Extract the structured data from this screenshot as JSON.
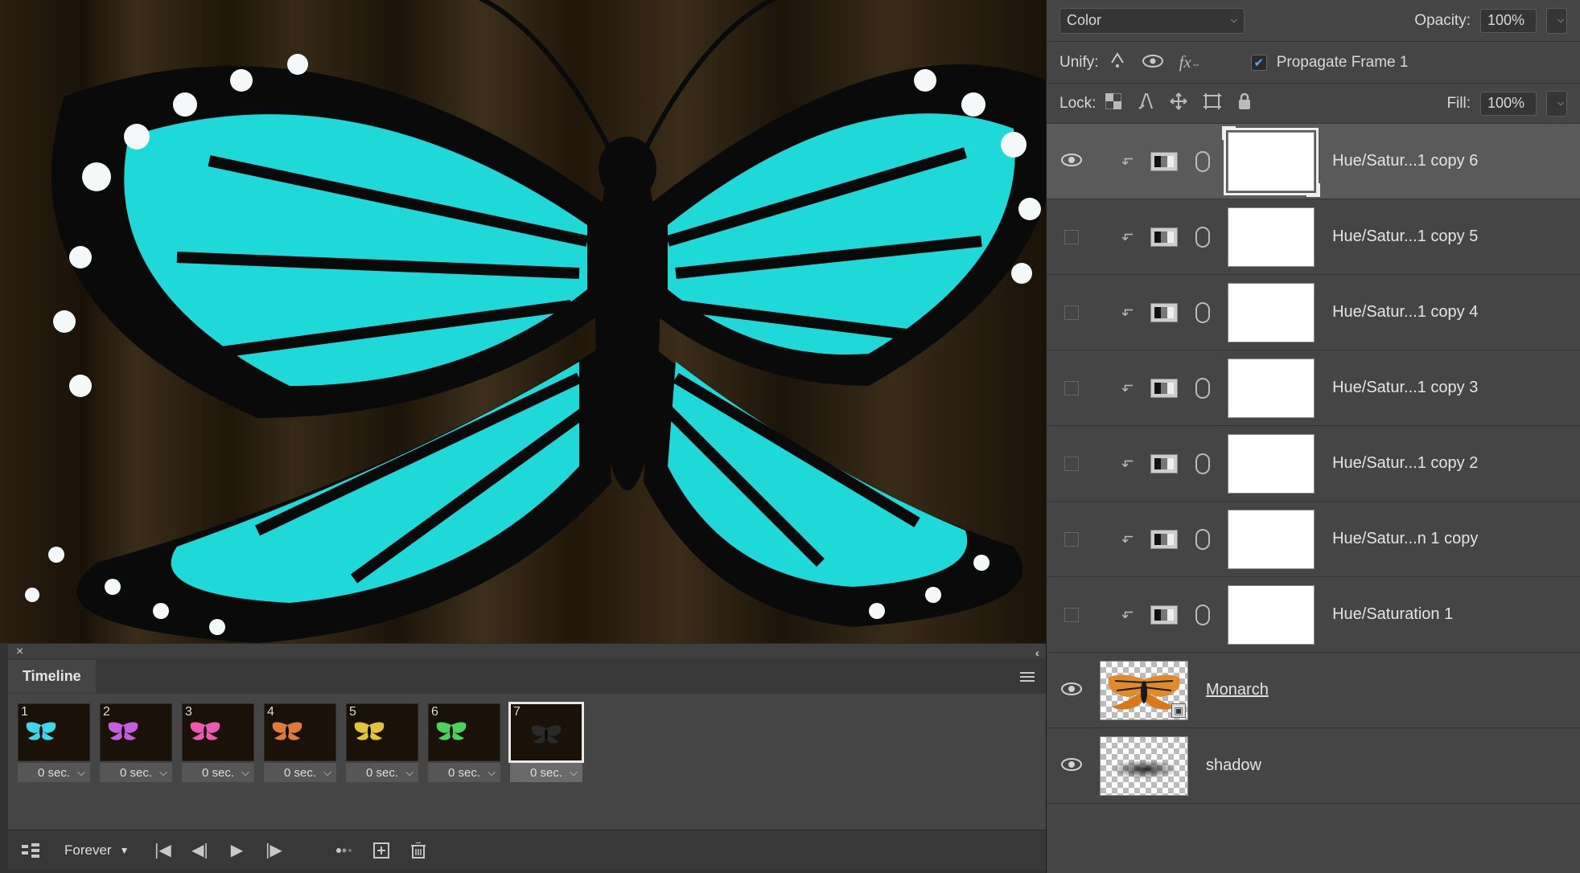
{
  "blend_mode": "Color",
  "opacity_label": "Opacity:",
  "opacity_value": "100%",
  "unify_label": "Unify:",
  "propagate_label": "Propagate Frame 1",
  "propagate_checked": true,
  "lock_label": "Lock:",
  "fill_label": "Fill:",
  "fill_value": "100%",
  "layers": [
    {
      "name": "Hue/Satur...1 copy 6",
      "visible": true,
      "selected": true,
      "kind": "adj"
    },
    {
      "name": "Hue/Satur...1 copy 5",
      "visible": false,
      "selected": false,
      "kind": "adj"
    },
    {
      "name": "Hue/Satur...1 copy 4",
      "visible": false,
      "selected": false,
      "kind": "adj"
    },
    {
      "name": "Hue/Satur...1 copy 3",
      "visible": false,
      "selected": false,
      "kind": "adj"
    },
    {
      "name": "Hue/Satur...1 copy 2",
      "visible": false,
      "selected": false,
      "kind": "adj"
    },
    {
      "name": "Hue/Satur...n 1 copy",
      "visible": false,
      "selected": false,
      "kind": "adj"
    },
    {
      "name": "Hue/Saturation 1",
      "visible": false,
      "selected": false,
      "kind": "adj"
    },
    {
      "name": "Monarch",
      "visible": true,
      "selected": false,
      "kind": "smart"
    },
    {
      "name": "shadow",
      "visible": true,
      "selected": false,
      "kind": "shadow"
    }
  ],
  "timeline": {
    "tab": "Timeline",
    "loop": "Forever",
    "frames": [
      {
        "n": "1",
        "delay": "0 sec.",
        "color": "#3fd7e8",
        "selected": false
      },
      {
        "n": "2",
        "delay": "0 sec.",
        "color": "#c45de0",
        "selected": false
      },
      {
        "n": "3",
        "delay": "0 sec.",
        "color": "#e85bb0",
        "selected": false
      },
      {
        "n": "4",
        "delay": "0 sec.",
        "color": "#e07a3a",
        "selected": false
      },
      {
        "n": "5",
        "delay": "0 sec.",
        "color": "#e0c43a",
        "selected": false
      },
      {
        "n": "6",
        "delay": "0 sec.",
        "color": "#4fd05a",
        "selected": false
      },
      {
        "n": "7",
        "delay": "0 sec.",
        "color": "#2a2a2a",
        "selected": true
      }
    ]
  },
  "canvas_color": "#1fd8d8"
}
